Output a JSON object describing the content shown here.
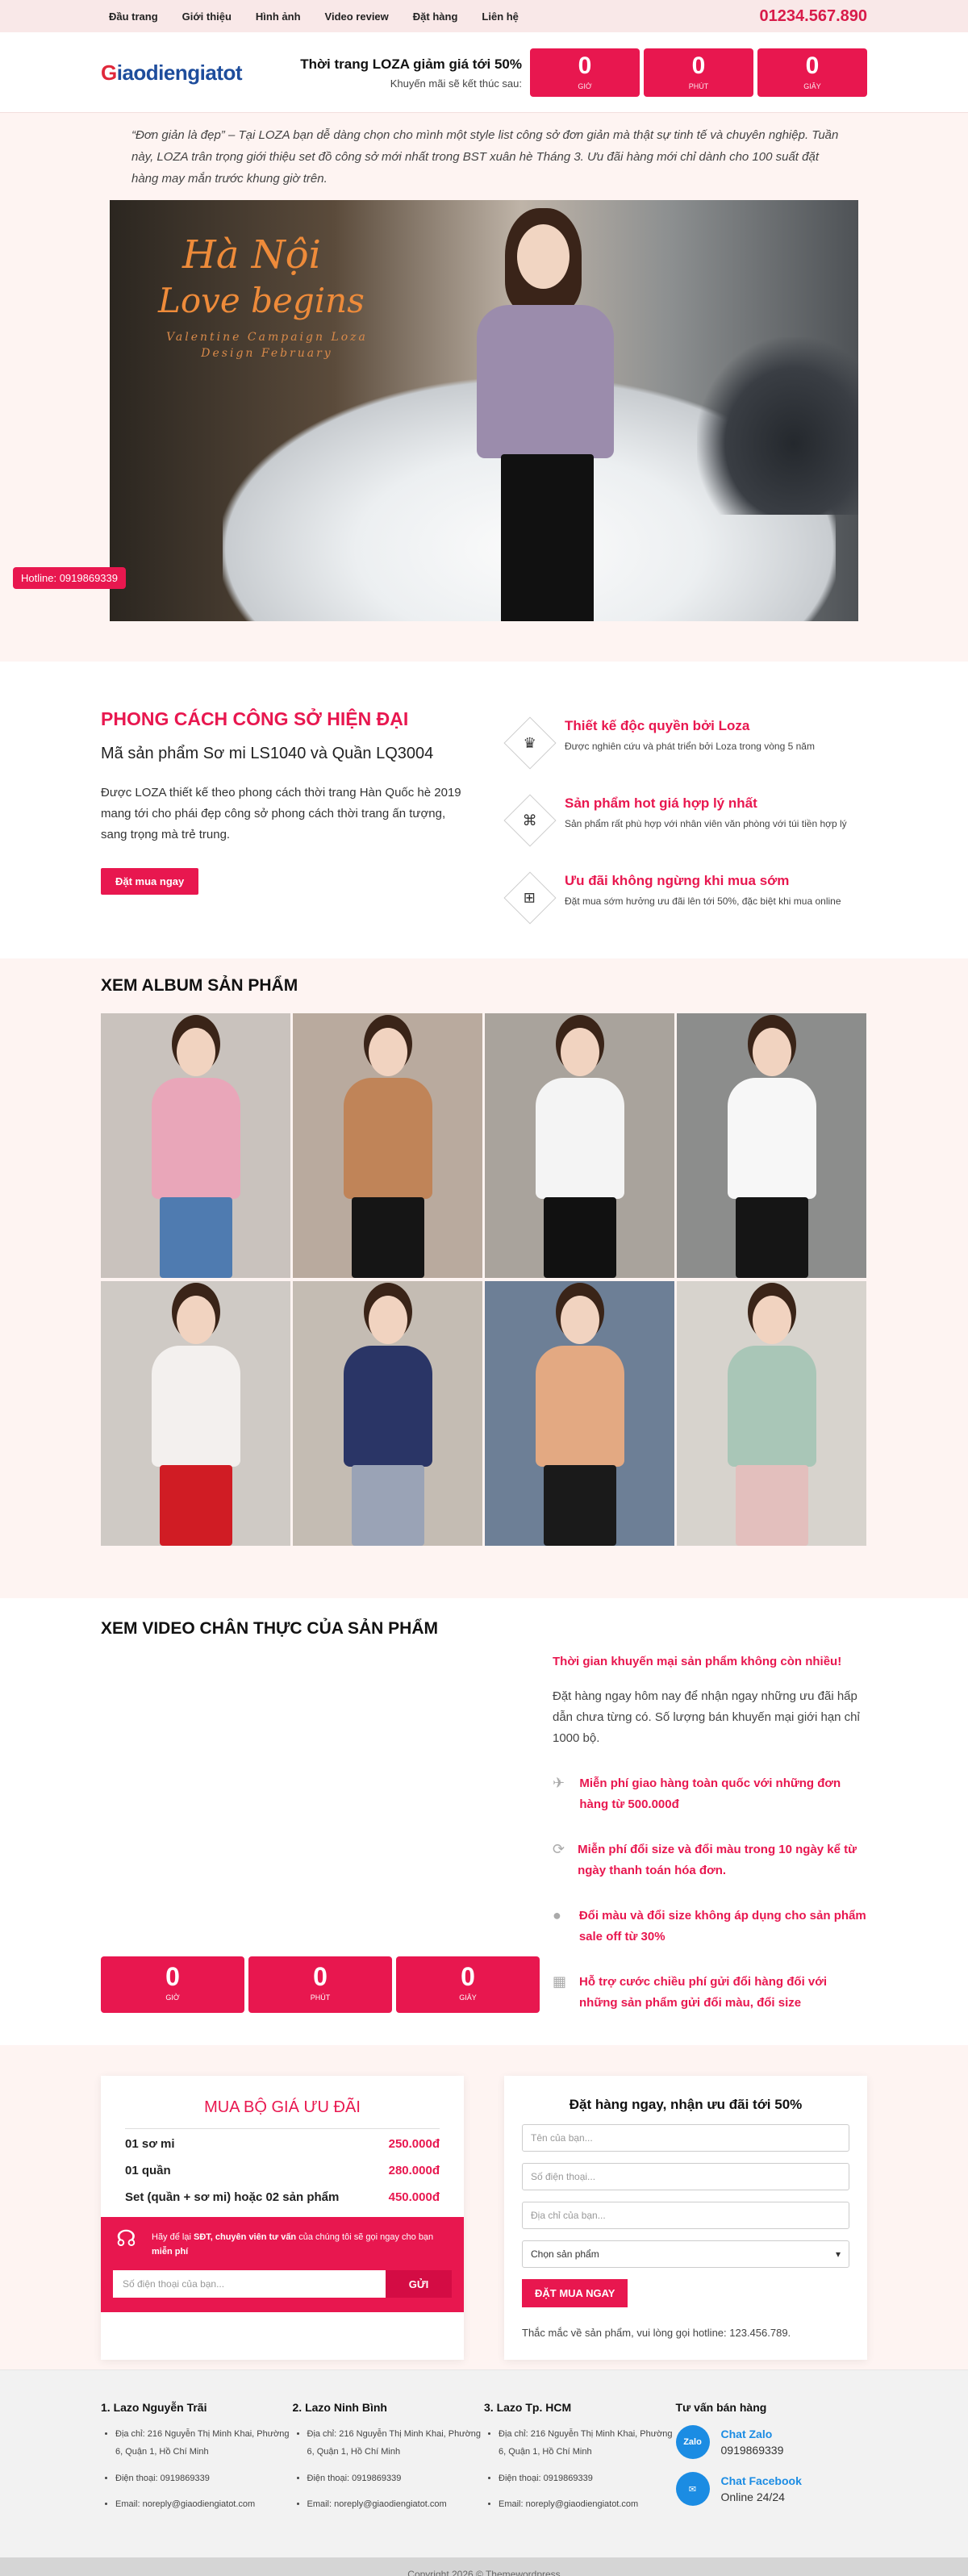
{
  "topbar": {
    "nav": [
      "Đầu trang",
      "Giới thiệu",
      "Hình ảnh",
      "Video review",
      "Đặt hàng",
      "Liên hệ"
    ],
    "phone": "01234.567.890"
  },
  "header": {
    "logo": "Giaodiengiatot",
    "logo_first": "G",
    "logo_rest": "iaodiengiatot",
    "promo_title": "Thời trang LOZA giảm giá tới 50%",
    "promo_sub": "Khuyến mãi sẽ kết thúc sau:",
    "countdown": [
      {
        "value": "0",
        "label": "GIỜ"
      },
      {
        "value": "0",
        "label": "PHÚT"
      },
      {
        "value": "0",
        "label": "GIÂY"
      }
    ]
  },
  "hero": {
    "quote": "“Đơn giản là đẹp” – Tại LOZA bạn dễ dàng chọn cho mình một style list công sở đơn giản mà thật sự tinh tế và chuyên nghiệp. Tuần này, LOZA trân trọng giới thiệu set đồ công sở mới nhất trong BST xuân hè Tháng 3. Ưu đãi hàng mới chỉ dành cho 100 suất đặt hàng may mắn trước khung giờ trên.",
    "banner_line1": "Hà Nội",
    "banner_line2": "Love begins",
    "banner_sub1": "Valentine Campaign Loza",
    "banner_sub2": "Design February",
    "hotline": "Hotline: 0919869339"
  },
  "features": {
    "title": "PHONG CÁCH CÔNG SỞ HIỆN ĐẠI",
    "subtitle": "Mã sản phẩm Sơ mi LS1040 và Quần LQ3004",
    "desc": "Được LOZA thiết kế theo phong cách thời trang Hàn Quốc hè 2019 mang tới cho phái đẹp công sở phong cách thời trang ấn tượng, sang trọng mà trẻ trung.",
    "button": "Đặt mua ngay",
    "items": [
      {
        "title": "Thiết kế độc quyền bởi Loza",
        "desc": "Được nghiên cứu và phát triển bởi Loza trong vòng 5 năm",
        "icon": "crown-icon"
      },
      {
        "title": "Sản phẩm hot giá hợp lý nhất",
        "desc": "Sản phẩm rất phù hợp với nhân viên văn phòng với túi tiền hợp lý",
        "icon": "tag-icon"
      },
      {
        "title": "Ưu đãi không ngừng khi mua sớm",
        "desc": "Đặt mua sớm hưởng ưu đãi lên tới 50%, đặc biệt khi mua online",
        "icon": "bag-icon"
      }
    ]
  },
  "album": {
    "title": "XEM ALBUM SẢN PHẨM",
    "photos": [
      {
        "top": "#e9a6b9",
        "bottom": "#4f7bb0",
        "bg": "#c9c2bd"
      },
      {
        "top": "#c08458",
        "bottom": "#151515",
        "bg": "#b9aa9e"
      },
      {
        "top": "#f4f4f4",
        "bottom": "#111111",
        "bg": "#a9a39c"
      },
      {
        "top": "#f7f7f7",
        "bottom": "#151515",
        "bg": "#8c8d8c"
      },
      {
        "top": "#f3f0ee",
        "bottom": "#d01c24",
        "bg": "#cfcac5"
      },
      {
        "top": "#2a3566",
        "bottom": "#9aa3b6",
        "bg": "#c4bcb3"
      },
      {
        "top": "#e3a982",
        "bottom": "#1a1a1a",
        "bg": "#6d7f96"
      },
      {
        "top": "#a9c6b7",
        "bottom": "#e3bfbd",
        "bg": "#d7d3cd"
      }
    ]
  },
  "video": {
    "title": "XEM VIDEO CHÂN THỰC CỦA SẢN PHẨM",
    "countdown": [
      {
        "value": "0",
        "label": "GIỜ"
      },
      {
        "value": "0",
        "label": "PHÚT"
      },
      {
        "value": "0",
        "label": "GIÂY"
      }
    ],
    "headline": "Thời gian khuyến mại sản phẩm không còn nhiều!",
    "para": "Đặt hàng ngay hôm nay để nhận ngay những ưu đãi hấp dẫn chưa từng có. Số lượng bán khuyến mại giới hạn chỉ 1000 bộ.",
    "items": [
      {
        "text": "Miễn phí giao hàng toàn quốc với những đơn hàng từ 500.000đ",
        "icon": "plane-icon"
      },
      {
        "text": "Miễn phí đổi size và đổi màu trong 10 ngày kể từ ngày thanh toán hóa đơn.",
        "icon": "refresh-icon"
      },
      {
        "text": "Đổi màu và đổi size không áp dụng cho sản phẩm sale off từ 30%",
        "icon": "circle-icon"
      },
      {
        "text": "Hỗ trợ cước chiều phí gửi đổi hàng đối với những sản phẩm gửi đổi màu, đổi size",
        "icon": "calendar-icon"
      }
    ]
  },
  "pricing": {
    "title": "MUA BỘ GIÁ ƯU ĐÃI",
    "rows": [
      {
        "name": "01 sơ mi",
        "price": "250.000đ"
      },
      {
        "name": "01 quần",
        "price": "280.000đ"
      },
      {
        "name": "Set (quần + sơ mi) hoặc 02 sản phẩm",
        "price": "450.000đ"
      }
    ],
    "note_pre": "Hãy để lại ",
    "note_bold": "SĐT, chuyên viên tư vấn",
    "note_mid": " của chúng tôi sẽ gọi ngay cho bạn ",
    "note_end": "miễn phí",
    "phone_placeholder": "Số điện thoại của bạn...",
    "send": "GỬI"
  },
  "order": {
    "title": "Đặt hàng ngay, nhận ưu đãi tới 50%",
    "name_placeholder": "Tên của bạn...",
    "phone_placeholder": "Số điện thoại...",
    "address_placeholder": "Địa chỉ của bạn...",
    "select_value": "Chọn sản phẩm",
    "button": "ĐẶT MUA NGAY",
    "hotline": "Thắc mắc về sản phẩm, vui lòng gọi hotline: 123.456.789."
  },
  "footer": {
    "stores": [
      {
        "title": "1. Lazo Nguyễn Trãi",
        "address": "Địa chỉ: 216 Nguyễn Thị Minh Khai, Phường 6, Quận 1, Hồ Chí Minh",
        "phone": "Điện thoại: 0919869339",
        "email": "Email: noreply@giaodiengiatot.com"
      },
      {
        "title": "2. Lazo Ninh Bình",
        "address": "Địa chỉ: 216 Nguyễn Thị Minh Khai, Phường 6, Quận 1, Hồ Chí Minh",
        "phone": "Điện thoại: 0919869339",
        "email": "Email: noreply@giaodiengiatot.com"
      },
      {
        "title": "3. Lazo Tp. HCM",
        "address": "Địa chỉ: 216 Nguyễn Thị Minh Khai, Phường 6, Quận 1, Hồ Chí Minh",
        "phone": "Điện thoại: 0919869339",
        "email": "Email: noreply@giaodiengiatot.com"
      }
    ],
    "support_title": "Tư vấn bán hàng",
    "zalo_label": "Chat Zalo",
    "zalo_value": "0919869339",
    "zalo_icon": "Zalo",
    "fb_label": "Chat Facebook",
    "fb_value": "Online 24/24",
    "copyright": "Copyright 2026 © Themewordpress"
  }
}
